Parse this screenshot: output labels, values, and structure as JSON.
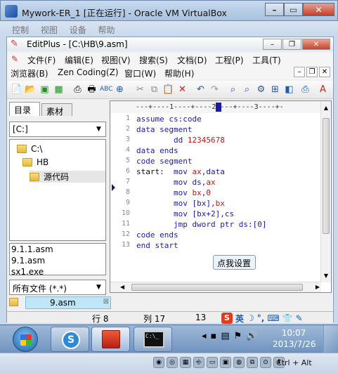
{
  "vbox": {
    "title": "Mywork-ER_1 [正在运行] - Oracle VM VirtualBox",
    "menu": [
      "控制",
      "视图",
      "设备",
      "帮助"
    ],
    "hostkey": "Ctrl + Alt"
  },
  "editplus": {
    "title": "EditPlus - [C:\\HB\\9.asm]",
    "menu_row1": [
      "文件(F)",
      "编辑(E)",
      "视图(V)",
      "搜索(S)",
      "文档(D)",
      "工程(P)",
      "工具(T)"
    ],
    "menu_row2": [
      "浏览器(B)",
      "Zen Coding(Z)",
      "窗口(W)",
      "帮助(H)"
    ],
    "panel_tabs": [
      "目录",
      "素材"
    ],
    "drive": "[C:]",
    "tree": [
      "C:\\",
      "HB",
      "源代码"
    ],
    "files": [
      "9.1.1.asm",
      "9.1.asm",
      "sx1.exe"
    ],
    "filter": "所有文件 (*.*)",
    "ruler": "---+----1----+----2----+----3----+-",
    "line_numbers": [
      "1",
      "2",
      "3",
      "4",
      "5",
      "6",
      "7",
      "8",
      "9",
      "10",
      "11",
      "12",
      "13"
    ],
    "code": [
      [
        {
          "t": "assume ",
          "c": "kw"
        },
        {
          "t": "cs",
          "c": "kw"
        },
        {
          "t": ":",
          "c": "kw"
        },
        {
          "t": "code",
          "c": "kw"
        }
      ],
      [
        {
          "t": "data segment",
          "c": "kw"
        }
      ],
      [
        {
          "t": "        ",
          "c": "txt"
        },
        {
          "t": "dd ",
          "c": "kw"
        },
        {
          "t": "12345678",
          "c": "num"
        }
      ],
      [
        {
          "t": "data ends",
          "c": "kw"
        }
      ],
      [
        {
          "t": "code segment",
          "c": "kw"
        }
      ],
      [
        {
          "t": "start:  ",
          "c": "txt"
        },
        {
          "t": "mov ",
          "c": "kw"
        },
        {
          "t": "ax",
          "c": "num"
        },
        {
          "t": ",data",
          "c": "kw"
        }
      ],
      [
        {
          "t": "        ",
          "c": "txt"
        },
        {
          "t": "mov ",
          "c": "kw"
        },
        {
          "t": "ds",
          "c": "kw"
        },
        {
          "t": ",",
          "c": "kw"
        },
        {
          "t": "ax",
          "c": "num"
        }
      ],
      [
        {
          "t": "        ",
          "c": "txt"
        },
        {
          "t": "mov ",
          "c": "kw"
        },
        {
          "t": "bx",
          "c": "num"
        },
        {
          "t": ",",
          "c": "kw"
        },
        {
          "t": "0",
          "c": "num"
        }
      ],
      [
        {
          "t": "        ",
          "c": "txt"
        },
        {
          "t": "mov ",
          "c": "kw"
        },
        {
          "t": "[bx]",
          "c": "kw"
        },
        {
          "t": ",",
          "c": "kw"
        },
        {
          "t": "bx",
          "c": "num"
        }
      ],
      [
        {
          "t": "        ",
          "c": "txt"
        },
        {
          "t": "mov ",
          "c": "kw"
        },
        {
          "t": "[bx+2]",
          "c": "kw"
        },
        {
          "t": ",cs",
          "c": "kw"
        }
      ],
      [
        {
          "t": "        ",
          "c": "txt"
        },
        {
          "t": "jmp ",
          "c": "kw"
        },
        {
          "t": "dword ptr ds:[0]",
          "c": "kw"
        }
      ],
      [
        {
          "t": "code ends",
          "c": "kw"
        }
      ],
      [
        {
          "t": "end start",
          "c": "kw"
        }
      ]
    ],
    "doc_tab": "9.asm",
    "tooltip": "点我设置",
    "status": {
      "row": "行 8",
      "col": "列 17",
      "val": "13"
    }
  },
  "sogou_bar": {
    "lang": "英"
  },
  "taskbar": {
    "time": "10:07",
    "date": "2013/7/26"
  }
}
